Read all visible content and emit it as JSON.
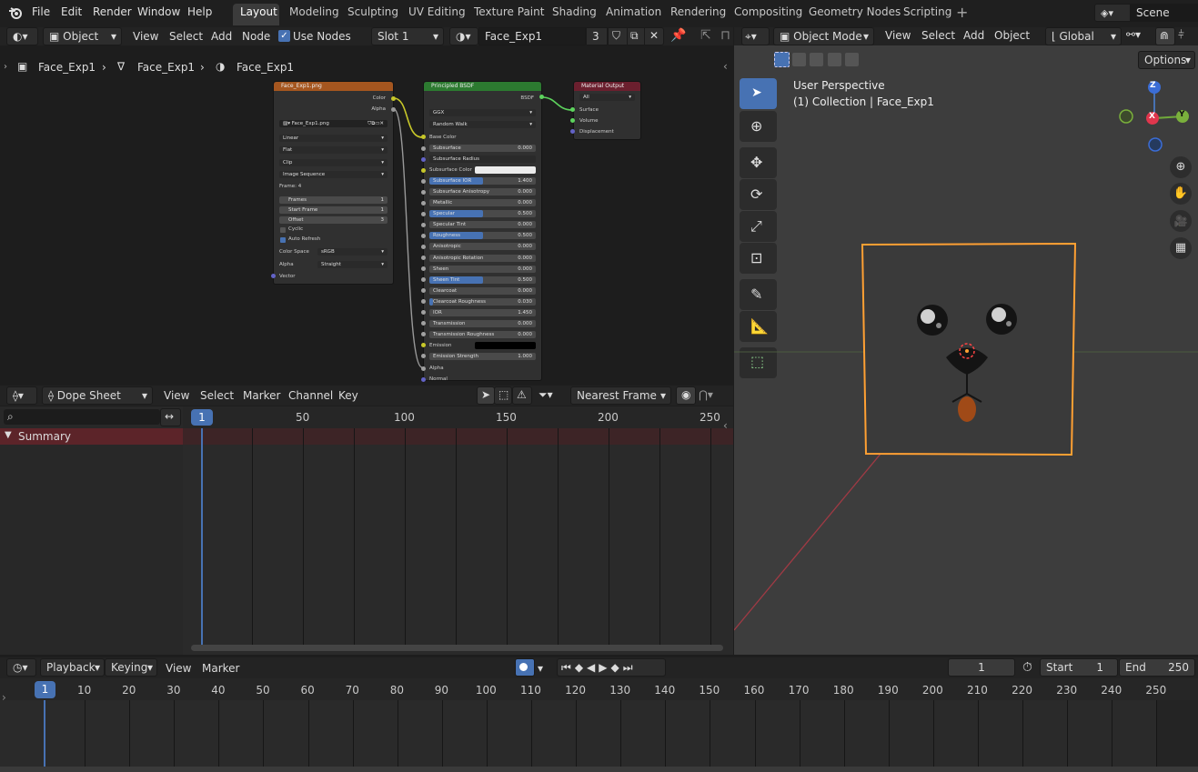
{
  "menu": {
    "file": "File",
    "edit": "Edit",
    "render": "Render",
    "window": "Window",
    "help": "Help"
  },
  "workspaces": [
    "Layout",
    "Modeling",
    "Sculpting",
    "UV Editing",
    "Texture Paint",
    "Shading",
    "Animation",
    "Rendering",
    "Compositing",
    "Geometry Nodes",
    "Scripting"
  ],
  "scene": {
    "name": "Scene"
  },
  "node_editor": {
    "object_dropdown": "Object",
    "view": "View",
    "select": "Select",
    "add": "Add",
    "node": "Node",
    "use_nodes": "Use Nodes",
    "slot": "Slot 1",
    "material": "Face_Exp1",
    "users": "3",
    "breadcrumb": [
      "Face_Exp1",
      "Face_Exp1",
      "Face_Exp1"
    ],
    "image_node": {
      "title": "Face_Exp1.png",
      "out_color": "Color",
      "out_alpha": "Alpha",
      "image": "Face_Exp1.png",
      "interp": "Linear",
      "proj": "Flat",
      "ext": "Clip",
      "source": "Image Sequence",
      "frame_label": "Frame: 4",
      "frames_l": "Frames",
      "frames_v": "1",
      "start_l": "Start Frame",
      "start_v": "1",
      "offset_l": "Offset",
      "offset_v": "3",
      "cyclic": "Cyclic",
      "auto_refresh": "Auto Refresh",
      "cs_l": "Color Space",
      "cs_v": "sRGB",
      "alpha_l": "Alpha",
      "alpha_v": "Straight",
      "vector": "Vector"
    },
    "bsdf_node": {
      "title": "Principled BSDF",
      "out": "BSDF",
      "dist": "GGX",
      "ssm": "Random Walk",
      "base_color": "Base Color",
      "rows": [
        {
          "l": "Subsurface",
          "v": "0.000",
          "f": 0
        },
        {
          "l": "Subsurface Radius",
          "v": "",
          "f": 0
        },
        {
          "l": "Subsurface Color",
          "v": "",
          "f": 0
        },
        {
          "l": "Subsurface IOR",
          "v": "1.400",
          "f": 0.5
        },
        {
          "l": "Subsurface Anisotropy",
          "v": "0.000",
          "f": 0
        },
        {
          "l": "Metallic",
          "v": "0.000",
          "f": 0
        },
        {
          "l": "Specular",
          "v": "0.500",
          "f": 0.5
        },
        {
          "l": "Specular Tint",
          "v": "0.000",
          "f": 0
        },
        {
          "l": "Roughness",
          "v": "0.500",
          "f": 0.5
        },
        {
          "l": "Anisotropic",
          "v": "0.000",
          "f": 0
        },
        {
          "l": "Anisotropic Rotation",
          "v": "0.000",
          "f": 0
        },
        {
          "l": "Sheen",
          "v": "0.000",
          "f": 0
        },
        {
          "l": "Sheen Tint",
          "v": "0.500",
          "f": 0.5
        },
        {
          "l": "Clearcoat",
          "v": "0.000",
          "f": 0
        },
        {
          "l": "Clearcoat Roughness",
          "v": "0.030",
          "f": 0.03
        },
        {
          "l": "IOR",
          "v": "1.450",
          "f": 0
        },
        {
          "l": "Transmission",
          "v": "0.000",
          "f": 0
        },
        {
          "l": "Transmission Roughness",
          "v": "0.000",
          "f": 0
        },
        {
          "l": "Emission",
          "v": "",
          "f": 0
        },
        {
          "l": "Emission Strength",
          "v": "1.000",
          "f": 0
        }
      ],
      "alpha": "Alpha",
      "normal": "Normal"
    },
    "output_node": {
      "title": "Material Output",
      "target": "All",
      "surface": "Surface",
      "volume": "Volume",
      "displacement": "Displacement"
    }
  },
  "viewport": {
    "mode": "Object Mode",
    "view": "View",
    "select": "Select",
    "add": "Add",
    "object": "Object",
    "orientation": "Global",
    "options": "Options",
    "title": "User Perspective",
    "subtitle": "(1) Collection | Face_Exp1",
    "axis_z": "Z",
    "axis_x": "X",
    "axis_y": "Y"
  },
  "dopesheet": {
    "mode": "Dope Sheet",
    "view": "View",
    "select": "Select",
    "marker": "Marker",
    "channel": "Channel",
    "key": "Key",
    "interp": "Nearest Frame",
    "summary": "Summary",
    "current": "1",
    "ticks": [
      "50",
      "100",
      "150",
      "200",
      "250"
    ]
  },
  "timeline": {
    "playback": "Playback",
    "keying": "Keying",
    "view": "View",
    "marker": "Marker",
    "current_frame": "1",
    "start_label": "Start",
    "start": "1",
    "end_label": "End",
    "end": "250",
    "current": "1",
    "ticks": [
      "10",
      "20",
      "30",
      "40",
      "50",
      "60",
      "70",
      "80",
      "90",
      "100",
      "110",
      "120",
      "130",
      "140",
      "150",
      "160",
      "170",
      "180",
      "190",
      "200",
      "210",
      "220",
      "230",
      "240",
      "250"
    ]
  },
  "colors": {
    "accent": "#4772b3",
    "select": "#ffa033",
    "image_node": "#a5561f",
    "shader_node": "#2c7a30",
    "output_node": "#6b1f2e"
  }
}
